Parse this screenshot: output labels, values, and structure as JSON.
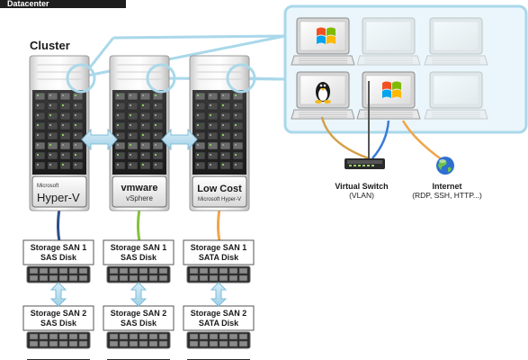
{
  "header": {
    "title": "Datacenter"
  },
  "cluster": {
    "label": "Cluster"
  },
  "servers": [
    {
      "vendor": "Microsoft",
      "product": "Hyper-V"
    },
    {
      "vendor": "vmware",
      "product": "vSphere"
    },
    {
      "vendor": "Microsoft Hyper-V",
      "product": "Low Cost"
    }
  ],
  "storage_san1": [
    {
      "line1": "Storage SAN 1",
      "line2": "SAS Disk"
    },
    {
      "line1": "Storage SAN 1",
      "line2": "SAS Disk"
    },
    {
      "line1": "Storage SAN 1",
      "line2": "SATA Disk"
    }
  ],
  "storage_san2": [
    {
      "line1": "Storage SAN 2",
      "line2": "SAS Disk"
    },
    {
      "line1": "Storage SAN 2",
      "line2": "SAS Disk"
    },
    {
      "line1": "Storage SAN 2",
      "line2": "SATA Disk"
    }
  ],
  "virtual_switch": {
    "title": "Virtual Switch",
    "subtitle": "(VLAN)"
  },
  "internet": {
    "title": "Internet",
    "subtitle": "(RDP, SSH, HTTP...)"
  },
  "vm_laptops": [
    {
      "os_icon": "windows-icon",
      "active": true
    },
    {
      "os_icon": "none",
      "active": false
    },
    {
      "os_icon": "none",
      "active": false
    },
    {
      "os_icon": "linux-icon",
      "active": true
    },
    {
      "os_icon": "windows-icon",
      "active": true
    },
    {
      "os_icon": "none",
      "active": false
    }
  ],
  "colors": {
    "highlight_line": "#a9d8ea",
    "vm_panel_bg": "#eaf6fb",
    "link_hyperv": "#2c4f8c",
    "link_vsphere": "#86c13a",
    "link_lowcost": "#f0a54a",
    "link_linux": "#d4a04a",
    "link_windows_blue": "#3b7bd8",
    "link_windows_orange": "#f0a54a",
    "link_switch": "#555555"
  }
}
